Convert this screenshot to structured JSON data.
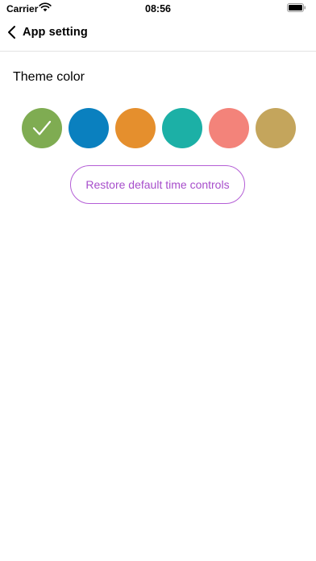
{
  "status_bar": {
    "carrier": "Carrier",
    "time": "08:56"
  },
  "nav": {
    "title": "App setting"
  },
  "theme": {
    "section_title": "Theme color",
    "selected_index": 0,
    "colors": [
      "#7fac52",
      "#0a80bf",
      "#e58f2d",
      "#1cb0a6",
      "#f3837a",
      "#c4a55c"
    ]
  },
  "restore_button": {
    "label": "Restore default time controls"
  }
}
